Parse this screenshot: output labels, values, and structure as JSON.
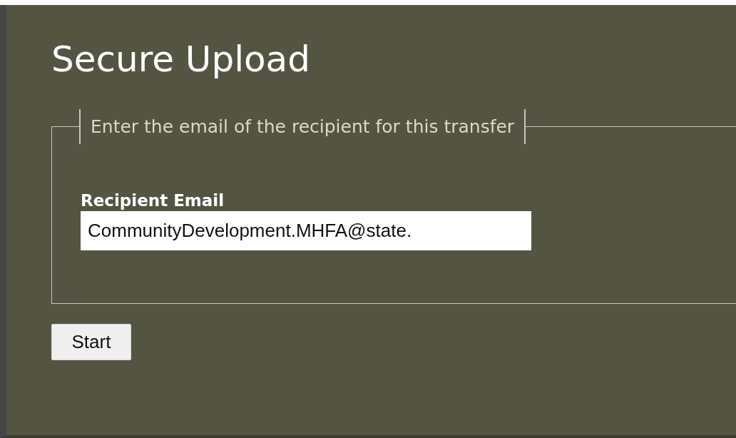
{
  "page": {
    "title": "Secure Upload"
  },
  "form": {
    "legend": "Enter the email of the recipient for this transfer",
    "field_label": "Recipient Email",
    "field_value": "CommunityDevelopment.MHFA@state."
  },
  "buttons": [
    "Start"
  ]
}
